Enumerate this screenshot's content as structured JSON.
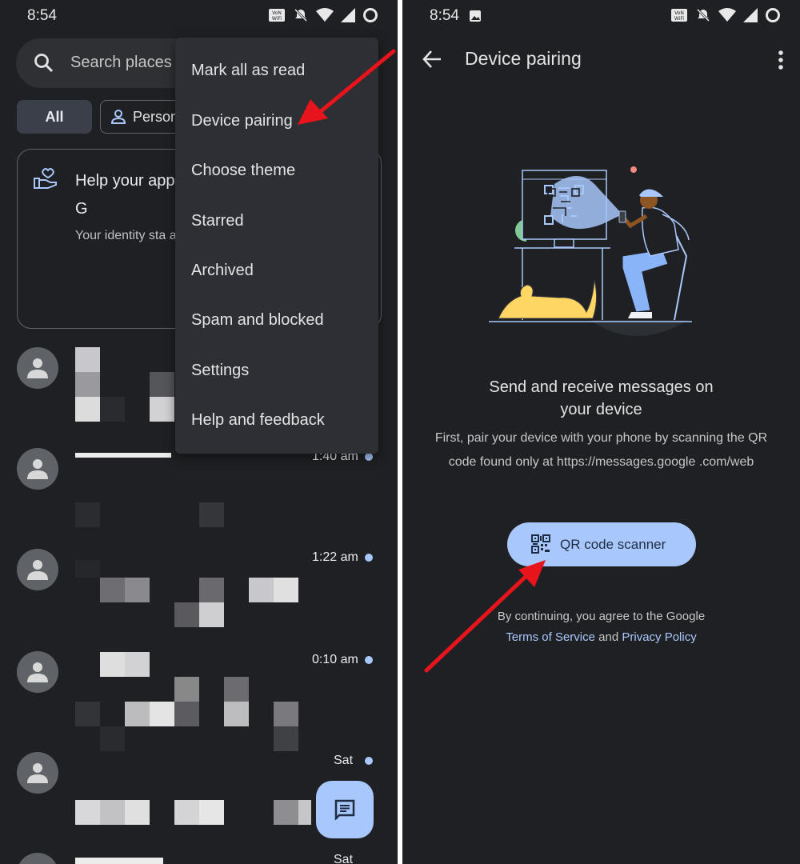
{
  "left": {
    "status": {
      "time": "8:54"
    },
    "search": {
      "placeholder": "Search places"
    },
    "chips": {
      "all": "All",
      "personal": "Person"
    },
    "promo": {
      "title": "Help your app donations to G",
      "body": "Your identity sta any message co"
    },
    "conversations": [
      {
        "time": "1:40 am",
        "unread": true
      },
      {
        "time": "1:22 am",
        "unread": true
      },
      {
        "time": "0:10 am",
        "unread": true
      },
      {
        "time": "Sat",
        "unread": true
      },
      {
        "time": "Sat",
        "unread": false
      }
    ],
    "menu": {
      "items": [
        "Mark all as read",
        "Device pairing",
        "Choose theme",
        "Starred",
        "Archived",
        "Spam and blocked",
        "Settings",
        "Help and feedback"
      ]
    },
    "icons": {
      "search": "search-icon",
      "personal": "person-icon",
      "promo": "heart-hand-icon",
      "avatar": "person-avatar-icon",
      "fab": "new-message-icon"
    }
  },
  "right": {
    "status": {
      "time": "8:54"
    },
    "page_title": "Device pairing",
    "headline": "Send and receive messages on your device",
    "instructions": "First, pair your device with your phone by scanning the QR code found only at https://messages.google .com/web",
    "qr_button": "QR code scanner",
    "legal": {
      "prefix": "By continuing, you agree to the Google",
      "tos": "Terms of Service",
      "and": "and",
      "privacy": "Privacy Policy"
    },
    "icons": {
      "back": "back-arrow-icon",
      "overflow": "more-vert-icon",
      "qr": "qr-code-icon"
    }
  },
  "colors": {
    "background": "#1f2023",
    "accent": "#a8c7fa",
    "annotation_arrow": "#e8141b"
  }
}
